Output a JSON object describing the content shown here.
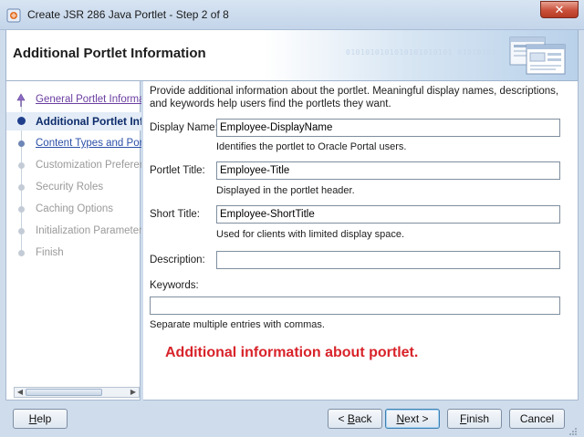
{
  "window": {
    "title": "Create JSR 286 Java Portlet - Step 2 of 8",
    "close_glyph": "✕"
  },
  "header": {
    "title": "Additional Portlet Information",
    "binary_text": "0101010101010101010101 01010101"
  },
  "nav": {
    "items": [
      {
        "label": "General Portlet Information",
        "state": "link-visited"
      },
      {
        "label": "Additional Portlet Information",
        "state": "current"
      },
      {
        "label": "Content Types and Portlet Modes",
        "state": "link"
      },
      {
        "label": "Customization Preferences",
        "state": "disabled"
      },
      {
        "label": "Security Roles",
        "state": "disabled"
      },
      {
        "label": "Caching Options",
        "state": "disabled"
      },
      {
        "label": "Initialization Parameters",
        "state": "disabled"
      },
      {
        "label": "Finish",
        "state": "disabled"
      }
    ]
  },
  "main": {
    "intro": "Provide additional information about the portlet. Meaningful display names, descriptions, and keywords help users find the portlets they want.",
    "display_name": {
      "label": "Display Name:",
      "value": "Employee-DisplayName",
      "hint": "Identifies the portlet to Oracle Portal users."
    },
    "portlet_title": {
      "label": "Portlet Title:",
      "value": "Employee-Title",
      "hint": "Displayed in the portlet header."
    },
    "short_title": {
      "label": "Short Title:",
      "value": "Employee-ShortTitle",
      "hint": "Used for clients with limited display space."
    },
    "description": {
      "label": "Description:",
      "value": ""
    },
    "keywords": {
      "label": "Keywords:",
      "value": "",
      "hint": "Separate multiple entries with commas."
    },
    "annotation": "Additional information about portlet."
  },
  "buttons": {
    "help_underlined": "H",
    "help_rest": "elp",
    "back_prefix": "< ",
    "back_underlined": "B",
    "back_rest": "ack",
    "next_underlined": "N",
    "next_rest": "ext >",
    "finish_underlined": "F",
    "finish_rest": "inish",
    "cancel": "Cancel"
  },
  "colors": {
    "accent": "#1f3f8c",
    "annotation": "#d8232a",
    "link": "#2b4fa8"
  }
}
